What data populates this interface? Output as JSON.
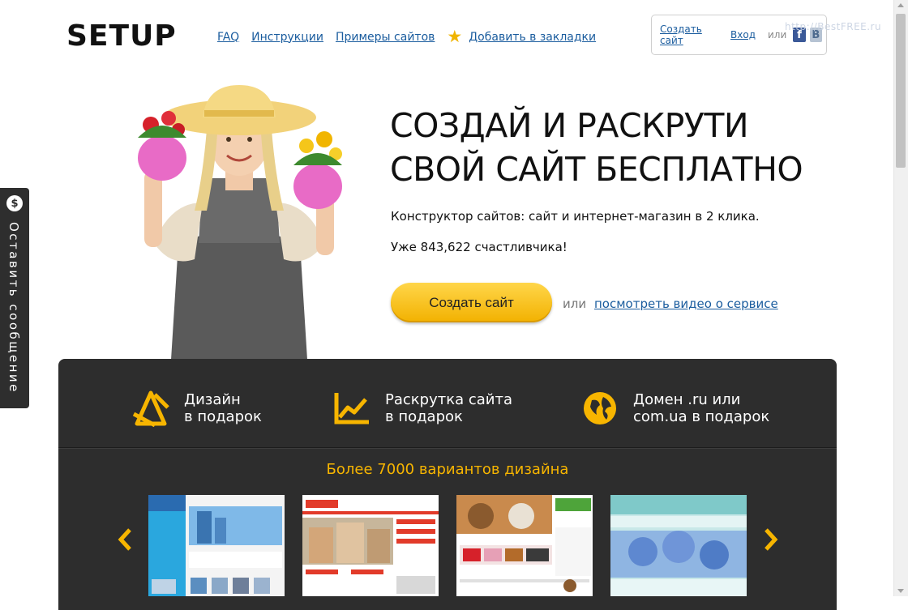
{
  "header": {
    "logo": "SETUP",
    "nav": [
      {
        "label": "FAQ"
      },
      {
        "label": "Инструкции"
      },
      {
        "label": "Примеры сайтов"
      }
    ],
    "bookmark_label": "Добавить в закладки",
    "login": {
      "create_link": "Создать сайт",
      "login_link": "Вход",
      "or": "или"
    },
    "watermark": "http://BestFREE.ru"
  },
  "feedback_tab": {
    "label": "Оставить сообщение",
    "icon": "$"
  },
  "hero": {
    "title_line1": "СОЗДАЙ И РАСКРУТИ",
    "title_line2": "СВОЙ САЙТ БЕСПЛАТНО",
    "subtitle": "Конструктор сайтов: сайт и интернет-магазин в 2 клика.",
    "counter": "Уже 843,622 счастливчика!",
    "cta_label": "Создать сайт",
    "cta_or": "или",
    "video_link": "посмотреть видео о сервисе"
  },
  "features": [
    {
      "line1": "Дизайн",
      "line2": "в подарок",
      "icon": "design-tools-icon"
    },
    {
      "line1": "Раскрутка сайта",
      "line2": "в подарок",
      "icon": "growth-chart-icon"
    },
    {
      "line1": "Домен .ru или",
      "line2": "com.ua в подарок",
      "icon": "globe-icon"
    }
  ],
  "designs": {
    "title": "Более 7000 вариантов дизайна",
    "thumbnails": [
      {
        "theme": "real-estate-blue"
      },
      {
        "theme": "real-estate-red"
      },
      {
        "theme": "pet-shop"
      },
      {
        "theme": "florist"
      }
    ]
  },
  "colors": {
    "accent_yellow": "#f7b500",
    "panel_dark": "#2d2d2d",
    "link_blue": "#1a5c9e"
  }
}
